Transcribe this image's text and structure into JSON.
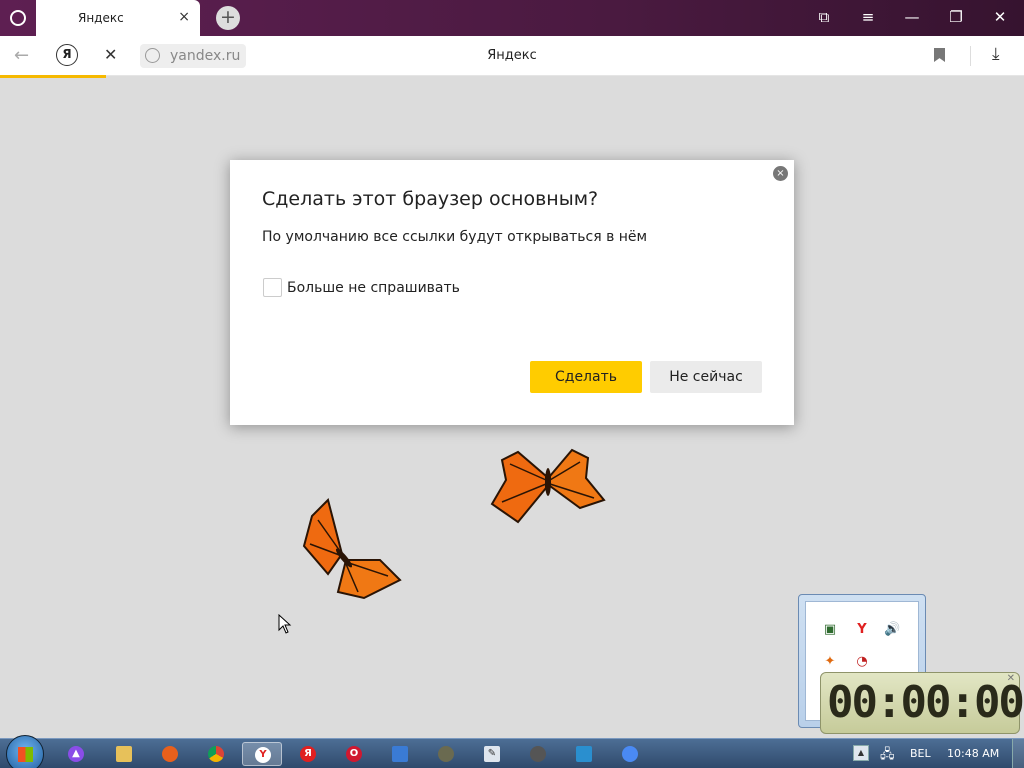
{
  "browser": {
    "tab_title": "Яндекс",
    "tab_close_icon": "×",
    "new_tab_icon": "+",
    "url": "yandex.ru",
    "page_title": "Яндекс",
    "yandex_button": "Я",
    "back_icon": "←",
    "stop_icon": "✕",
    "download_icon": "⤓",
    "window_controls": {
      "collections": "⧉",
      "menu": "≡",
      "minimize": "—",
      "restore": "❐",
      "close": "✕"
    }
  },
  "dialog": {
    "title": "Сделать этот браузер основным?",
    "text": "По умолчанию все ссылки будут открываться в нём",
    "checkbox_label": "Больше не спрашивать",
    "checkbox_checked": false,
    "primary_button": "Сделать",
    "secondary_button": "Не сейчас",
    "close_icon": "×",
    "primary_color": "#ffcc00"
  },
  "desktop": {
    "clock_gadget": "00:00:00"
  },
  "tray_popup": {
    "icons": [
      "network-tool-icon",
      "yandex-icon",
      "volume-icon",
      "butterfly-icon",
      "clock-icon"
    ]
  },
  "taskbar": {
    "apps": [
      "alice-icon",
      "explorer-icon",
      "firefox-icon",
      "chrome-icon",
      "yandex-browser-icon",
      "yandex-icon",
      "opera-icon",
      "app-icon",
      "gimp-icon",
      "writer-icon",
      "tor-icon",
      "monitor-icon",
      "chromium-icon"
    ],
    "active_app": "yandex-browser-icon",
    "language": "BEL",
    "time": "10:48 AM",
    "tray_arrow": "▲"
  }
}
